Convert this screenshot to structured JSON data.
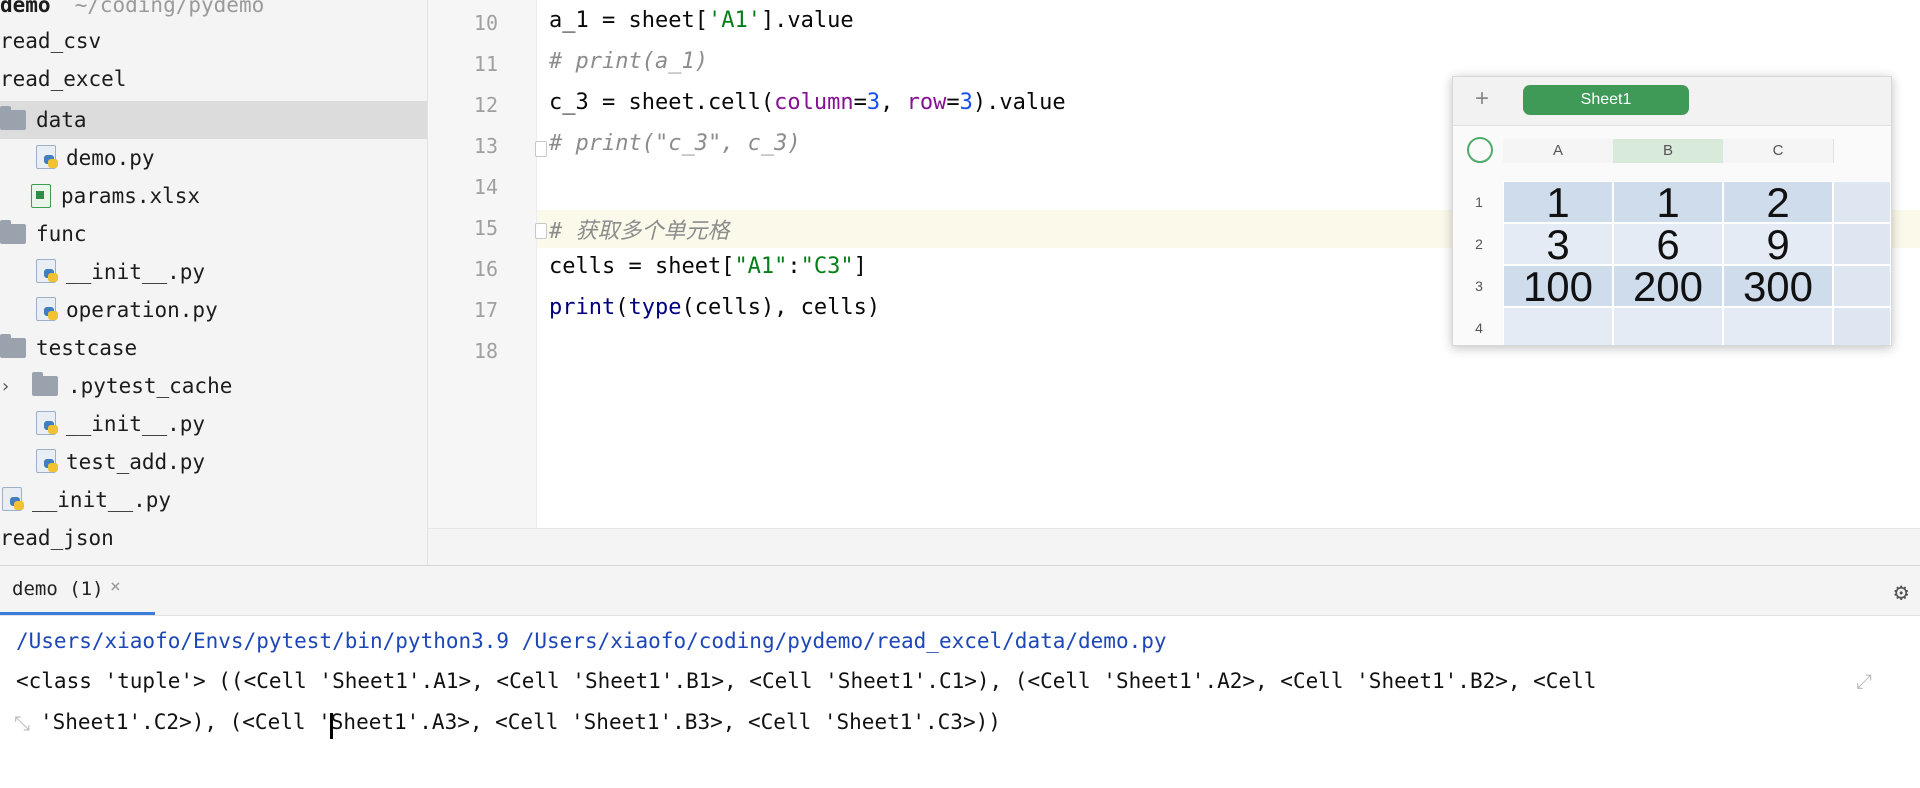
{
  "project_tree": {
    "root_label": "demo",
    "root_path": "~/coding/pydemo",
    "items": [
      {
        "label": "read_csv"
      },
      {
        "label": "read_excel"
      },
      {
        "label": "data"
      },
      {
        "label": "demo.py"
      },
      {
        "label": "params.xlsx"
      },
      {
        "label": "func"
      },
      {
        "label": "__init__.py"
      },
      {
        "label": "operation.py"
      },
      {
        "label": "testcase"
      },
      {
        "label": ".pytest_cache"
      },
      {
        "label": "__init__.py"
      },
      {
        "label": "test_add.py"
      },
      {
        "label": "__init__.py"
      },
      {
        "label": "read_json"
      }
    ]
  },
  "editor": {
    "line_numbers": [
      "10",
      "11",
      "12",
      "13",
      "14",
      "15",
      "16",
      "17",
      "18"
    ],
    "lines": {
      "l10": {
        "var": "a_1 = sheet[",
        "str": "'A1'",
        "rest": "].value"
      },
      "l11": {
        "comment": "# print(a_1)"
      },
      "l12": {
        "pre": "c_3 = sheet.cell(",
        "k1": "column",
        "eq1": "=",
        "n1": "3",
        "sep": ", ",
        "k2": "row",
        "eq2": "=",
        "n2": "3",
        "post": ").value"
      },
      "l13": {
        "comment": "# print(\"c_3\", c_3)"
      },
      "l15": {
        "comment": "# 获取多个单元格"
      },
      "l16": {
        "pre": "cells = sheet[",
        "s1": "\"A1\"",
        "colon": ":",
        "s2": "\"C3\"",
        "post": "]"
      },
      "l17": {
        "fn": "print",
        "open": "(",
        "fn2": "type",
        "rest": "(cells), cells)"
      }
    }
  },
  "spreadsheet": {
    "add_symbol": "+",
    "sheet_tab": "Sheet1",
    "columns": [
      "A",
      "B",
      "C"
    ],
    "row_numbers": [
      "1",
      "2",
      "3",
      "4"
    ],
    "rows": [
      [
        "1",
        "1",
        "2"
      ],
      [
        "3",
        "6",
        "9"
      ],
      [
        "100",
        "200",
        "300"
      ]
    ]
  },
  "run_panel": {
    "tab_label": "demo (1)",
    "close_symbol": "×",
    "gear_symbol": "⚙",
    "command": "/Users/xiaofo/Envs/pytest/bin/python3.9 /Users/xiaofo/coding/pydemo/read_excel/data/demo.py",
    "output_line1": "<class 'tuple'> ((<Cell 'Sheet1'.A1>, <Cell 'Sheet1'.B1>, <Cell 'Sheet1'.C1>), (<Cell 'Sheet1'.A2>, <Cell 'Sheet1'.B2>, <Cell",
    "output_line2": "'Sheet1'.C2>), (<Cell 'Sheet1'.A3>, <Cell 'Sheet1'.B3>, <Cell 'Sheet1'.C3>))"
  },
  "icons": {
    "folder": "folder-icon",
    "python_file": "python-file-icon",
    "excel_file": "excel-file-icon",
    "gear": "gear-icon",
    "wrap": "soft-wrap-icon"
  },
  "colors": {
    "comment": "#8c8c8c",
    "string": "#067d17",
    "keyword_arg": "#871094",
    "number": "#1750eb",
    "path": "#1d47b7",
    "sheet_tab": "#3f9a58",
    "cell": "#cfdcec"
  }
}
